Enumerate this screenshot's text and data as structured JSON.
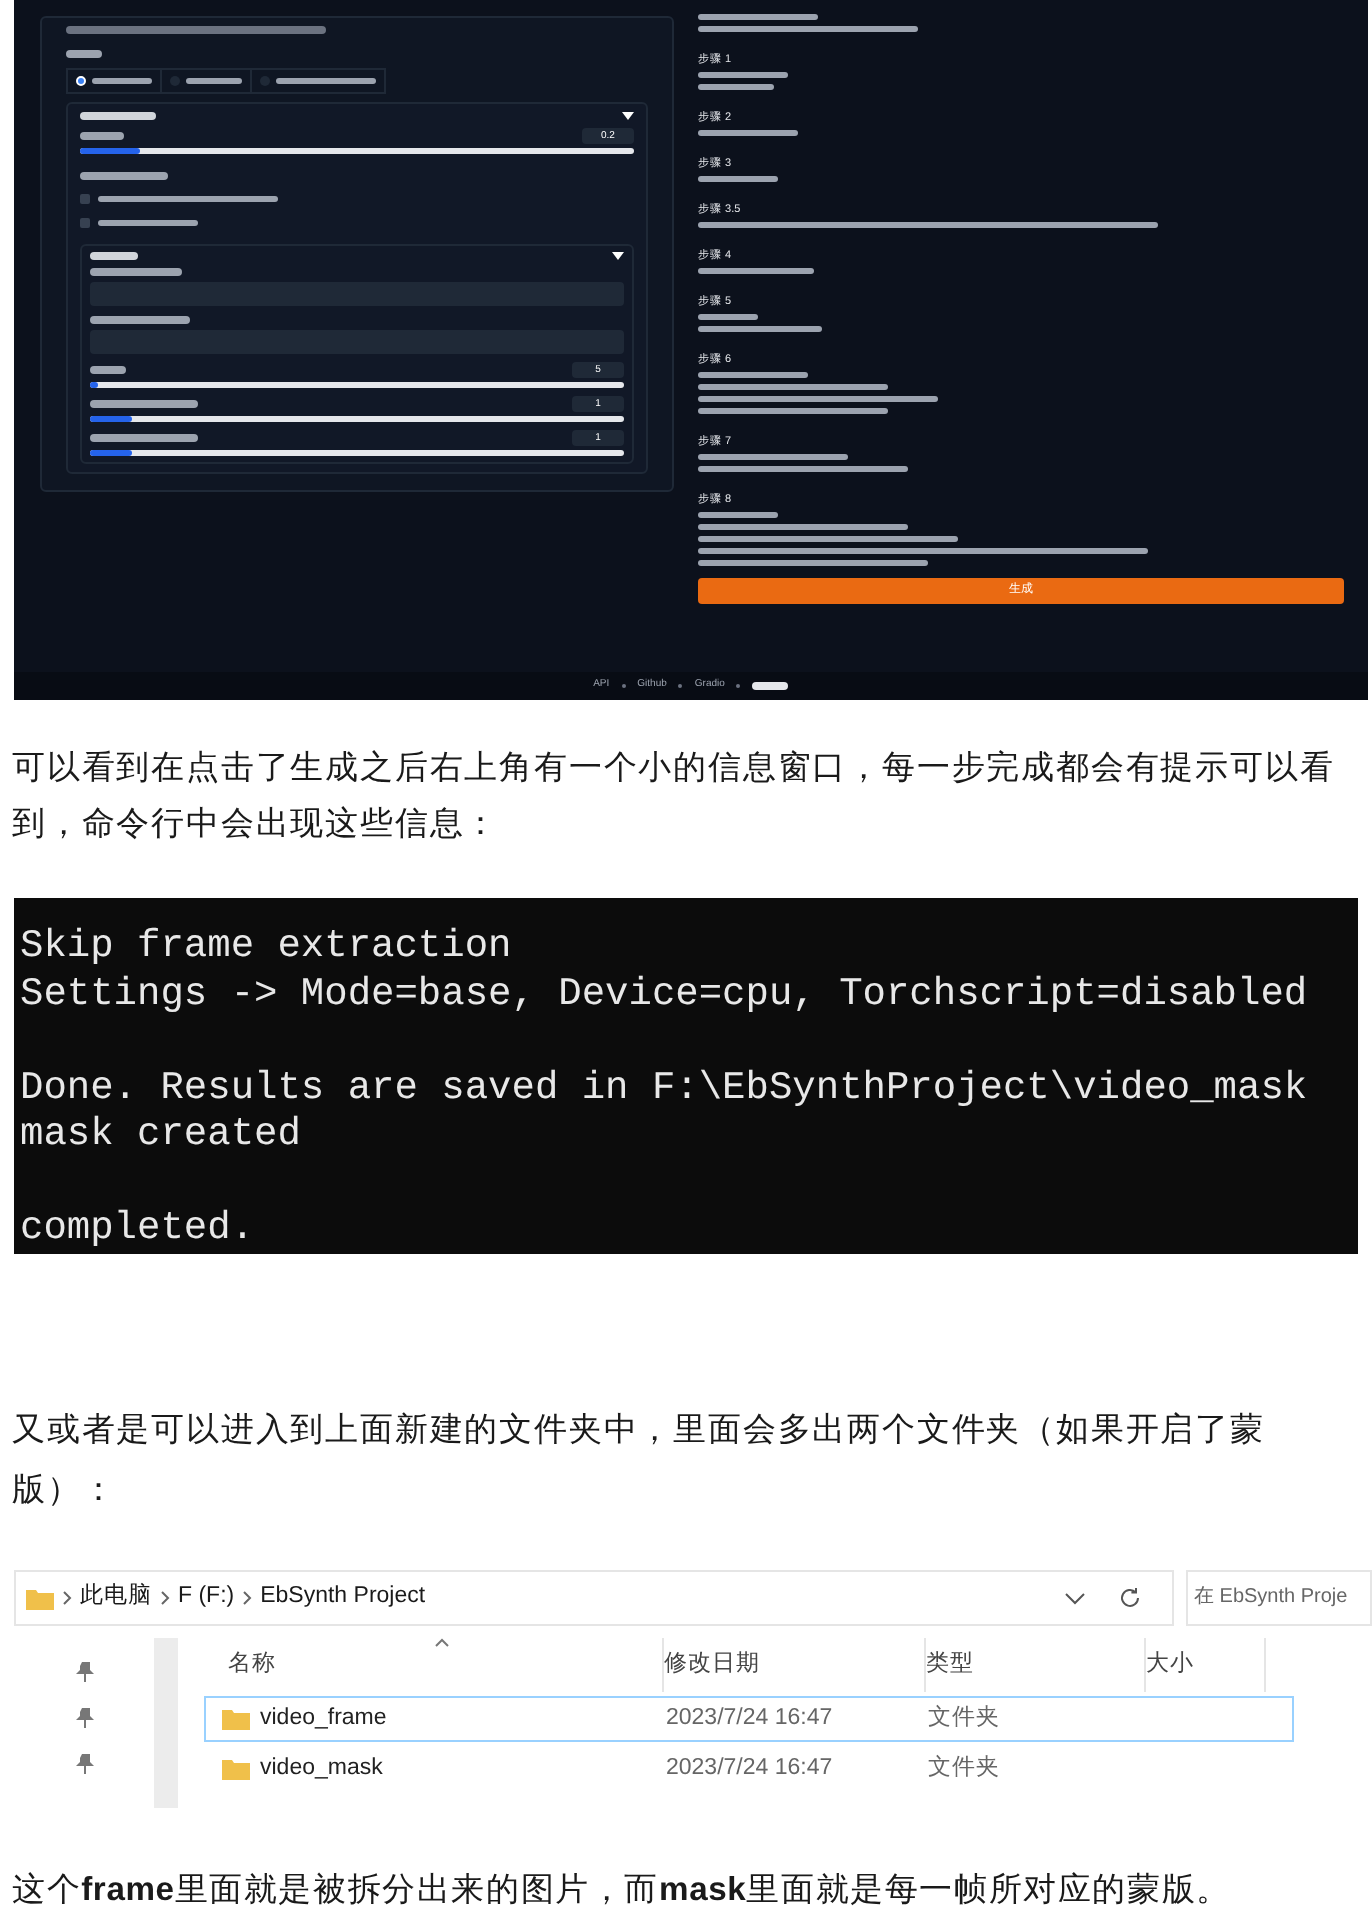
{
  "webui_screenshot": {
    "radio_options": [
      {
        "selected": true
      },
      {
        "selected": false
      },
      {
        "selected": false
      }
    ],
    "sliders": [
      {
        "level": 0.11,
        "value": "0.2"
      },
      {
        "level": 0.0,
        "value": "5"
      },
      {
        "level": 0.08,
        "value": "1"
      },
      {
        "level": 0.08,
        "value": "1"
      }
    ],
    "checkboxes": [
      {
        "checked": false
      },
      {
        "checked": false
      }
    ],
    "steps": [
      {
        "title": "步骤 1"
      },
      {
        "title": "步骤 2"
      },
      {
        "title": "步骤 3"
      },
      {
        "title": "步骤 3.5"
      },
      {
        "title": "步骤 4"
      },
      {
        "title": "步骤 5"
      },
      {
        "title": "步骤 6"
      },
      {
        "title": "步骤 7"
      },
      {
        "title": "步骤 8"
      }
    ],
    "generate_button": "生成",
    "footer_links": [
      "API",
      "Github",
      "Gradio"
    ]
  },
  "paragraph_1": "可以看到在点击了生成之后右上角有一个小的信息窗口，每一步完成都会有提示可以看到，命令行中会出现这些信息：",
  "terminal_blocks": [
    [
      "Skip frame extraction",
      "Settings -> Mode=base, Device=cpu, Torchscript=disabled"
    ],
    [
      "Done. Results are saved in F:\\EbSynthProject\\video_mask",
      "mask created"
    ],
    [
      "completed."
    ]
  ],
  "paragraph_2": "又或者是可以进入到上面新建的文件夹中，里面会多出两个文件夹（如果开启了蒙版）：",
  "explorer": {
    "breadcrumb": [
      "此电脑",
      "F (F:)",
      "EbSynth Project"
    ],
    "search_placeholder": "在 EbSynth Proje",
    "columns": [
      "名称",
      "修改日期",
      "类型",
      "大小"
    ],
    "rows": [
      {
        "name": "video_frame",
        "date": "2023/7/24 16:47",
        "type": "文件夹",
        "selected": true
      },
      {
        "name": "video_mask",
        "date": "2023/7/24 16:47",
        "type": "文件夹",
        "selected": false
      }
    ]
  },
  "paragraph_3": "这个**frame**里面就是被拆分出来的图片，而**mask**里面就是每一帧所对应的蒙版。"
}
